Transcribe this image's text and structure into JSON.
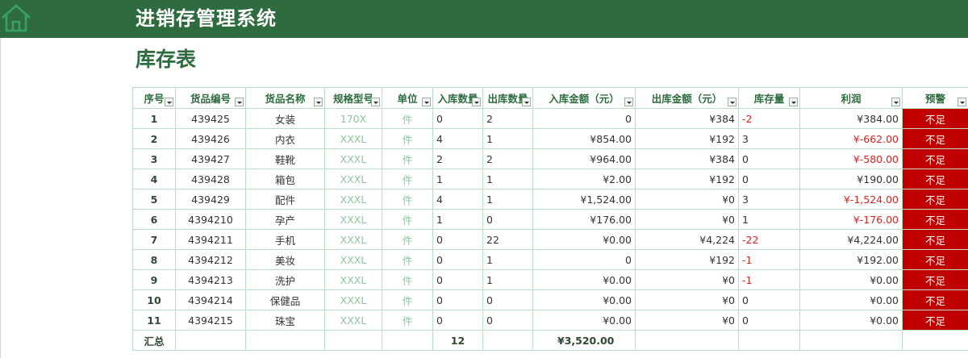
{
  "app": {
    "title": "进销存管理系统",
    "home_icon": "home-icon"
  },
  "page": {
    "title": "库存表"
  },
  "colors": {
    "brand": "#2e6b3f",
    "alert": "#c00000",
    "negative": "#e02020",
    "muted": "#8cc79b"
  },
  "table": {
    "columns": [
      "序号",
      "货品编号",
      "货品名称",
      "规格型号",
      "单位",
      "入库数量",
      "出库数量",
      "入库金额（元）",
      "出库金额（元）",
      "库存量",
      "利润",
      "预警"
    ],
    "rows": [
      {
        "seq": "1",
        "code": "439425",
        "name": "女装",
        "spec": "170X",
        "unit": "件",
        "in_qty": "0",
        "out_qty": "2",
        "in_amt": "0",
        "out_amt": "¥384",
        "stock": "-2",
        "profit": "¥384.00",
        "alert": "不足"
      },
      {
        "seq": "2",
        "code": "439426",
        "name": "内衣",
        "spec": "XXXL",
        "unit": "件",
        "in_qty": "4",
        "out_qty": "1",
        "in_amt": "¥854.00",
        "out_amt": "¥192",
        "stock": "3",
        "profit": "¥-662.00",
        "alert": "不足"
      },
      {
        "seq": "3",
        "code": "439427",
        "name": "鞋靴",
        "spec": "XXXL",
        "unit": "件",
        "in_qty": "2",
        "out_qty": "2",
        "in_amt": "¥964.00",
        "out_amt": "¥384",
        "stock": "0",
        "profit": "¥-580.00",
        "alert": "不足"
      },
      {
        "seq": "4",
        "code": "439428",
        "name": "箱包",
        "spec": "XXXL",
        "unit": "件",
        "in_qty": "1",
        "out_qty": "1",
        "in_amt": "¥2.00",
        "out_amt": "¥192",
        "stock": "0",
        "profit": "¥190.00",
        "alert": "不足"
      },
      {
        "seq": "5",
        "code": "439429",
        "name": "配件",
        "spec": "XXXL",
        "unit": "件",
        "in_qty": "4",
        "out_qty": "1",
        "in_amt": "¥1,524.00",
        "out_amt": "¥0",
        "stock": "3",
        "profit": "¥-1,524.00",
        "alert": "不足"
      },
      {
        "seq": "6",
        "code": "4394210",
        "name": "孕产",
        "spec": "XXXL",
        "unit": "件",
        "in_qty": "1",
        "out_qty": "0",
        "in_amt": "¥176.00",
        "out_amt": "¥0",
        "stock": "1",
        "profit": "¥-176.00",
        "alert": "不足"
      },
      {
        "seq": "7",
        "code": "4394211",
        "name": "手机",
        "spec": "XXXL",
        "unit": "件",
        "in_qty": "0",
        "out_qty": "22",
        "in_amt": "¥0.00",
        "out_amt": "¥4,224",
        "stock": "-22",
        "profit": "¥4,224.00",
        "alert": "不足"
      },
      {
        "seq": "8",
        "code": "4394212",
        "name": "美妆",
        "spec": "XXXL",
        "unit": "件",
        "in_qty": "0",
        "out_qty": "1",
        "in_amt": "0",
        "out_amt": "¥192",
        "stock": "-1",
        "profit": "¥192.00",
        "alert": "不足"
      },
      {
        "seq": "9",
        "code": "4394213",
        "name": "洗护",
        "spec": "XXXL",
        "unit": "件",
        "in_qty": "0",
        "out_qty": "1",
        "in_amt": "¥0.00",
        "out_amt": "¥0",
        "stock": "-1",
        "profit": "¥0.00",
        "alert": "不足"
      },
      {
        "seq": "10",
        "code": "4394214",
        "name": "保健品",
        "spec": "XXXL",
        "unit": "件",
        "in_qty": "0",
        "out_qty": "0",
        "in_amt": "¥0.00",
        "out_amt": "¥0",
        "stock": "0",
        "profit": "¥0.00",
        "alert": "不足"
      },
      {
        "seq": "11",
        "code": "4394215",
        "name": "珠宝",
        "spec": "XXXL",
        "unit": "件",
        "in_qty": "0",
        "out_qty": "0",
        "in_amt": "¥0.00",
        "out_amt": "¥0",
        "stock": "0",
        "profit": "¥0.00",
        "alert": "不足"
      }
    ],
    "total": {
      "label": "汇总",
      "in_qty": "12",
      "in_amt": "¥3,520.00"
    }
  }
}
